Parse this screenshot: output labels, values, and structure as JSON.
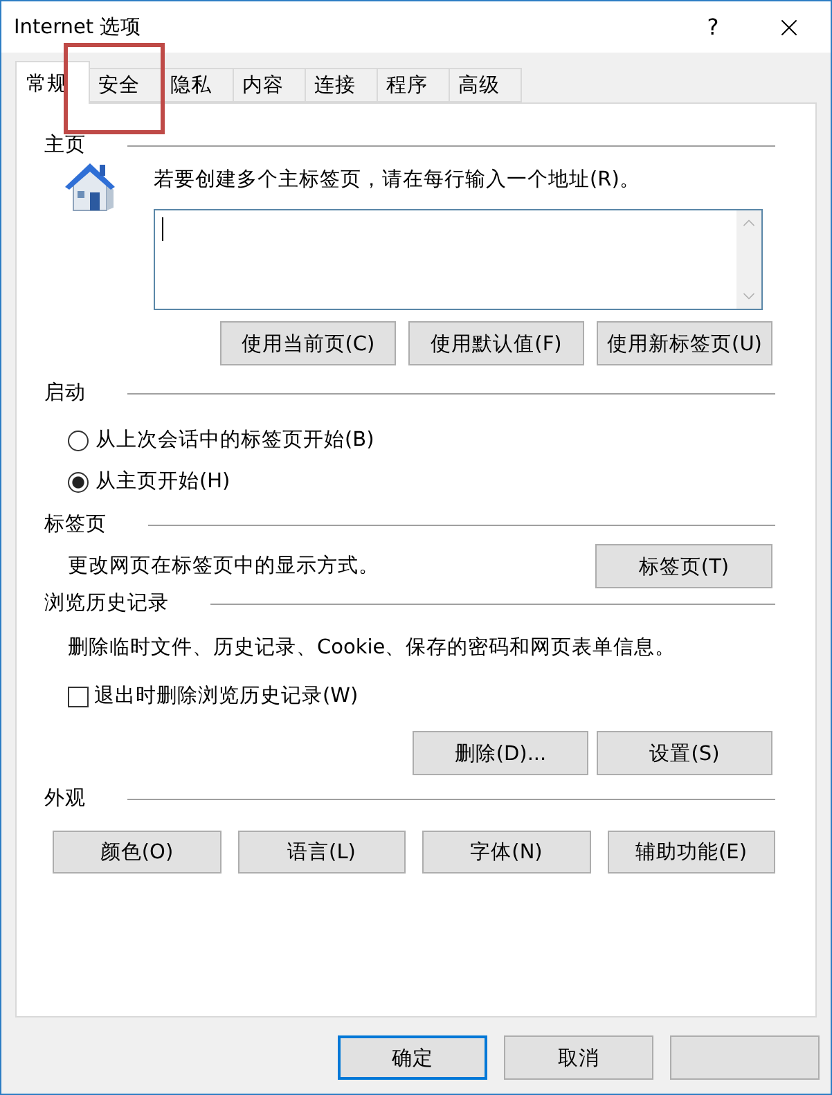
{
  "window": {
    "title": "Internet 选项",
    "help_label": "?"
  },
  "tabs": [
    {
      "label": "常规",
      "selected": true,
      "highlighted": false
    },
    {
      "label": "安全",
      "selected": false,
      "highlighted": true
    },
    {
      "label": "隐私",
      "selected": false,
      "highlighted": false
    },
    {
      "label": "内容",
      "selected": false,
      "highlighted": false
    },
    {
      "label": "连接",
      "selected": false,
      "highlighted": false
    },
    {
      "label": "程序",
      "selected": false,
      "highlighted": false
    },
    {
      "label": "高级",
      "selected": false,
      "highlighted": false
    }
  ],
  "sections": [
    {
      "kind": "home",
      "title": "主页",
      "hint": "若要创建多个主标签页，请在每行输入一个地址(R)。",
      "address_field": {
        "focused": true
      },
      "buttons": [
        "使用当前页(C)",
        "使用默认值(F)",
        "使用新标签页(U)"
      ]
    },
    {
      "kind": "radios",
      "title": "启动",
      "options": [
        {
          "label": "从上次会话中的标签页开始(B)",
          "selected": false
        },
        {
          "label": "从主页开始(H)",
          "selected": true
        }
      ]
    },
    {
      "kind": "text_button",
      "title": "标签页",
      "text": "更改网页在标签页中的显示方式。",
      "buttons": [
        "标签页(T)"
      ]
    },
    {
      "kind": "history",
      "title": "浏览历史记录",
      "text": "删除临时文件、历史记录、Cookie、保存的密码和网页表单信息。",
      "checkbox": {
        "label": "退出时删除浏览历史记录(W)",
        "checked": false
      },
      "buttons": [
        "删除(D)...",
        "设置(S)"
      ]
    },
    {
      "kind": "buttons",
      "title": "外观",
      "buttons": [
        "颜色(O)",
        "语言(L)",
        "字体(N)",
        "辅助功能(E)"
      ]
    }
  ],
  "footer": {
    "buttons": [
      {
        "kind": "text",
        "label": "确定",
        "focused": true
      },
      {
        "kind": "text",
        "label": "取消",
        "focused": false
      },
      {
        "kind": "blank",
        "focused": false
      }
    ]
  }
}
